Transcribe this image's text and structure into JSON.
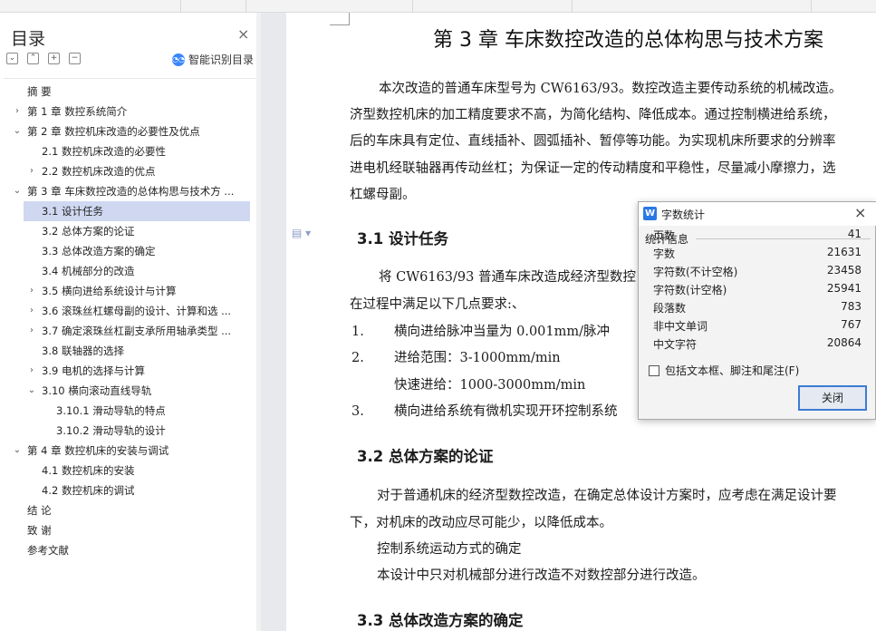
{
  "nav": {
    "title": "目录",
    "close_icon": "×",
    "smart_toc_label": "智能识别目录",
    "tools": [
      "⌄",
      "⌃",
      "+",
      "−"
    ],
    "items": [
      {
        "label": "摘    要",
        "level": 1,
        "arrow": ""
      },
      {
        "label": "第 1 章  数控系统简介",
        "level": 1,
        "arrow": "›"
      },
      {
        "label": "第 2 章  数控机床改造的必要性及优点",
        "level": 1,
        "arrow": "⌄"
      },
      {
        "label": "2.1  数控机床改造的必要性",
        "level": 2,
        "arrow": ""
      },
      {
        "label": "2.2  数控机床改造的优点",
        "level": 2,
        "arrow": "›"
      },
      {
        "label": "第 3 章  车床数控改造的总体构思与技术方 ...",
        "level": 1,
        "arrow": "⌄"
      },
      {
        "label": "3.1  设计任务",
        "level": 2,
        "arrow": "",
        "selected": true
      },
      {
        "label": "3.2  总体方案的论证",
        "level": 2,
        "arrow": ""
      },
      {
        "label": "3.3  总体改造方案的确定",
        "level": 2,
        "arrow": ""
      },
      {
        "label": "3.4  机械部分的改造",
        "level": 2,
        "arrow": ""
      },
      {
        "label": "3.5  横向进给系统设计与计算",
        "level": 2,
        "arrow": "›"
      },
      {
        "label": "3.6 滚珠丝杠螺母副的设计、计算和选 ...",
        "level": 2,
        "arrow": "›"
      },
      {
        "label": "3.7 确定滚珠丝杠副支承所用轴承类型 ...",
        "level": 2,
        "arrow": "›"
      },
      {
        "label": "3.8 联轴器的选择",
        "level": 2,
        "arrow": ""
      },
      {
        "label": "3.9 电机的选择与计算",
        "level": 2,
        "arrow": "›"
      },
      {
        "label": "3.10 横向滚动直线导轨",
        "level": 2,
        "arrow": "⌄"
      },
      {
        "label": "3.10.1 滑动导轨的特点",
        "level": 3,
        "arrow": ""
      },
      {
        "label": "3.10.2 滑动导轨的设计",
        "level": 3,
        "arrow": ""
      },
      {
        "label": "第 4 章  数控机床的安装与调试",
        "level": 1,
        "arrow": "⌄"
      },
      {
        "label": "4.1 数控机床的安装",
        "level": 2,
        "arrow": ""
      },
      {
        "label": "4.2 数控机床的调试",
        "level": 2,
        "arrow": ""
      },
      {
        "label": "结    论",
        "level": 1,
        "arrow": ""
      },
      {
        "label": "致    谢",
        "level": 1,
        "arrow": ""
      },
      {
        "label": "参考文献",
        "level": 1,
        "arrow": ""
      }
    ]
  },
  "document": {
    "chapter_title": "第 3 章  车床数控改造的总体构思与技术方案",
    "intro": [
      "本次改造的普通车床型号为 CW6163/93。数控改造主要传动系统的机械改造。",
      "济型数控机床的加工精度要求不高，为简化结构、降低成本。通过控制横进给系统，",
      "后的车床具有定位、直线插补、圆弧插补、暂停等功能。为实现机床所要求的分辨率",
      "进电机经联轴器再传动丝杠；为保证一定的传动精度和平稳性，尽量减小摩擦力，选",
      "杠螺母副。"
    ],
    "s31_title": "3.1  设计任务",
    "s31_line1": "将 CW6163/93 普通车床改造成经济型数控",
    "s31_line2": "在过程中满足以下几点要求:、",
    "list": [
      {
        "num": "1.",
        "text": "横向进给脉冲当量为 0.001mm/脉冲"
      },
      {
        "num": "2.",
        "text": "进给范围：3-1000mm/min"
      },
      {
        "num": "",
        "text": "快速进给：1000-3000mm/min"
      },
      {
        "num": "3.",
        "text": "横向进给系统有微机实现开环控制系统"
      }
    ],
    "s32_title": "3.2  总体方案的论证",
    "s32_lines": [
      "对于普通机床的经济型数控改造，在确定总体设计方案时，应考虑在满足设计要",
      "下，对机床的改动应尽可能少，以降低成本。",
      "控制系统运动方式的确定",
      "本设计中只对机械部分进行改造不对数控部分进行改造。"
    ],
    "s33_title": "3.3  总体改造方案的确定"
  },
  "dialog": {
    "title": "字数统计",
    "icon": "W",
    "close_icon": "×",
    "section_label": "统计信息",
    "stats": [
      {
        "label": "页数",
        "value": "41"
      },
      {
        "label": "字数",
        "value": "21631"
      },
      {
        "label": "字符数(不计空格)",
        "value": "23458"
      },
      {
        "label": "字符数(计空格)",
        "value": "25941"
      },
      {
        "label": "段落数",
        "value": "783"
      },
      {
        "label": "非中文单词",
        "value": "767"
      },
      {
        "label": "中文字符",
        "value": "20864"
      }
    ],
    "checkbox_label": "包括文本框、脚注和尾注(F)",
    "checkbox_checked": false,
    "close_button": "关闭"
  },
  "colors": {
    "selected_bg": "#cfd8f0",
    "accent": "#3d7bd6",
    "icon_blue": "#2a78e4"
  }
}
